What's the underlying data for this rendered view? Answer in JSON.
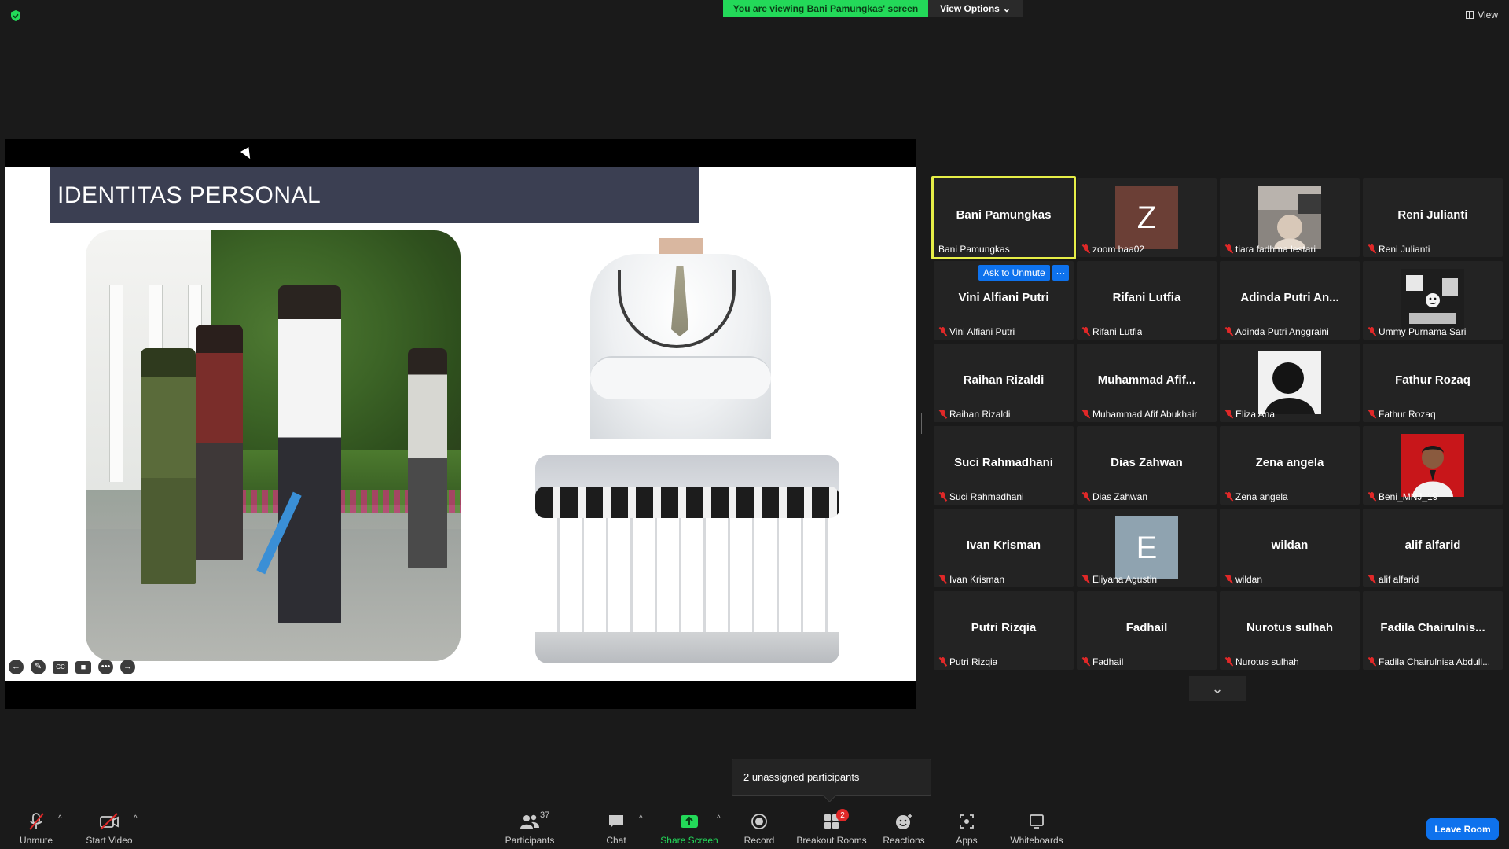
{
  "topbar": {
    "viewing_text": "You are viewing Bani Pamungkas' screen",
    "view_options_label": "View Options",
    "view_label": "View",
    "security_icon": "shield-check-icon",
    "banner_color": "#23d959"
  },
  "slide": {
    "title": "IDENTITAS PERSONAL",
    "title_bar_color": "#3b3f52",
    "controls": [
      "back-arrow-icon",
      "pen-icon",
      "cc-icon",
      "video-off-icon",
      "more-icon",
      "forward-arrow-icon"
    ]
  },
  "gallery": {
    "ask_to_unmute_label": "Ask to Unmute",
    "more_label": "···",
    "active_border_color": "#e6ee47",
    "tiles": [
      {
        "center": "Bani Pamungkas",
        "label": "Bani Pamungkas",
        "muted": false,
        "active": true
      },
      {
        "center": "",
        "label": "zoom baa02",
        "muted": true,
        "avatar_letter": "Z",
        "avatar_color": "#6b3f36"
      },
      {
        "center": "",
        "label": "tiara fadhma lestari",
        "muted": true,
        "photo": "tiara-photo"
      },
      {
        "center": "Reni Julianti",
        "label": "Reni Julianti",
        "muted": true
      },
      {
        "center": "Vini Alfiani Putri",
        "label": "Vini Alfiani Putri",
        "muted": true
      },
      {
        "center": "Rifani Lutfia",
        "label": "Rifani Lutfia",
        "muted": true
      },
      {
        "center": "Adinda Putri An...",
        "label": "Adinda Putri Anggraini",
        "muted": true
      },
      {
        "center": "",
        "label": "Ummy Purnama Sari",
        "muted": true,
        "photo": "ummy-photo"
      },
      {
        "center": "Raihan Rizaldi",
        "label": "Raihan Rizaldi",
        "muted": true
      },
      {
        "center": "Muhammad  Afif...",
        "label": "Muhammad Afif Abukhair",
        "muted": true
      },
      {
        "center": "",
        "label": "Eliza Ana",
        "muted": true,
        "photo": "eliza-photo"
      },
      {
        "center": "Fathur Rozaq",
        "label": "Fathur Rozaq",
        "muted": true
      },
      {
        "center": "Suci Rahmadhani",
        "label": "Suci Rahmadhani",
        "muted": true
      },
      {
        "center": "Dias Zahwan",
        "label": "Dias Zahwan",
        "muted": true
      },
      {
        "center": "Zena angela",
        "label": "Zena angela",
        "muted": true
      },
      {
        "center": "",
        "label": "Beni_MNJ_19",
        "muted": true,
        "photo": "beni-photo"
      },
      {
        "center": "Ivan Krisman",
        "label": "Ivan Krisman",
        "muted": true
      },
      {
        "center": "",
        "label": "Eliyana Agustin",
        "muted": true,
        "avatar_letter": "E",
        "avatar_color": "#8fa3b0"
      },
      {
        "center": "wildan",
        "label": "wildan",
        "muted": true
      },
      {
        "center": "alif alfarid",
        "label": "alif alfarid",
        "muted": true
      },
      {
        "center": "Putri Rizqia",
        "label": "Putri Rizqia",
        "muted": true
      },
      {
        "center": "Fadhail",
        "label": "Fadhail",
        "muted": true
      },
      {
        "center": "Nurotus sulhah",
        "label": "Nurotus sulhah",
        "muted": true
      },
      {
        "center": "Fadila  Chairulnis...",
        "label": "Fadila Chairulnisa Abdull...",
        "muted": true
      }
    ]
  },
  "notification": {
    "text": "2 unassigned participants"
  },
  "toolbar": {
    "unmute_label": "Unmute",
    "start_video_label": "Start Video",
    "participants_label": "Participants",
    "participants_count": "37",
    "chat_label": "Chat",
    "share_screen_label": "Share Screen",
    "record_label": "Record",
    "breakout_label": "Breakout Rooms",
    "breakout_badge": "2",
    "reactions_label": "Reactions",
    "apps_label": "Apps",
    "whiteboards_label": "Whiteboards",
    "leave_label": "Leave Room",
    "accent": "#0e72ed",
    "share_color": "#23d959"
  }
}
